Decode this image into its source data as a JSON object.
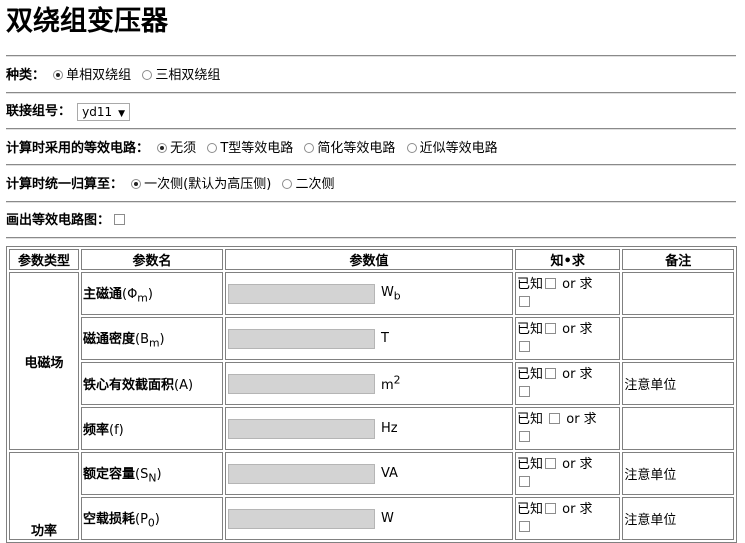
{
  "page_title": "双绕组变压器",
  "type_row": {
    "label": "种类：",
    "options": [
      "单相双绕组",
      "三相双绕组"
    ],
    "selected": "单相双绕组"
  },
  "connection_row": {
    "label": "联接组号：",
    "value": "yd11"
  },
  "circuit_row": {
    "label": "计算时采用的等效电路：",
    "options": [
      "无须",
      "T型等效电路",
      "简化等效电路",
      "近似等效电路"
    ],
    "selected": "无须"
  },
  "refer_row": {
    "label": "计算时统一归算至：",
    "options": [
      "一次侧(默认为高压侧)",
      "二次侧"
    ],
    "selected": "一次侧(默认为高压侧)"
  },
  "draw_row": {
    "label": "画出等效电路图：",
    "checked": false
  },
  "table": {
    "headers": [
      "参数类型",
      "参数名",
      "参数值",
      "知•求",
      "备注"
    ],
    "known_label": "已知",
    "or_label": "or 求",
    "groups": [
      {
        "category": "电磁场",
        "rows": [
          {
            "name": "主磁通",
            "symbol": "Φ",
            "sub": "m",
            "unit": "W",
            "unit_sub": "b",
            "unit_sup": "",
            "note": ""
          },
          {
            "name": "磁通密度",
            "symbol": "B",
            "sub": "m",
            "unit": "T",
            "unit_sub": "",
            "unit_sup": "",
            "note": ""
          },
          {
            "name": "铁心有效截面积",
            "symbol": "A",
            "sub": "",
            "unit": "m",
            "unit_sub": "",
            "unit_sup": "2",
            "note": "注意单位"
          },
          {
            "name": "频率",
            "symbol": "f",
            "sub": "",
            "unit": "Hz",
            "unit_sub": "",
            "unit_sup": "",
            "note": ""
          }
        ]
      },
      {
        "category": "功率",
        "rows": [
          {
            "name": "额定容量",
            "symbol": "S",
            "sub": "N",
            "unit": "VA",
            "unit_sub": "",
            "unit_sup": "",
            "note": "注意单位"
          },
          {
            "name": "空载损耗",
            "symbol": "P",
            "sub": "0",
            "unit": "W",
            "unit_sub": "",
            "unit_sup": "",
            "note": "注意单位"
          }
        ]
      }
    ]
  }
}
